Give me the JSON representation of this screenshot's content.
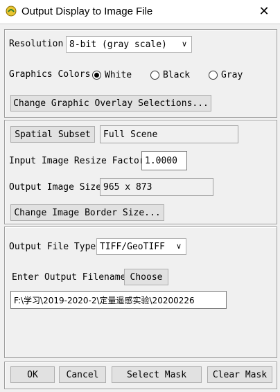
{
  "window": {
    "title": "Output Display to Image File",
    "close_glyph": "✕"
  },
  "display": {
    "resolution_label": "Resolution",
    "resolution_value": "8-bit (gray scale)",
    "graphics_colors_label": "Graphics Colors",
    "radio_white": "White",
    "radio_black": "Black",
    "radio_gray": "Gray",
    "selected_color": "White",
    "overlay_button": "Change Graphic Overlay Selections..."
  },
  "subset": {
    "spatial_subset_button": "Spatial Subset",
    "spatial_subset_value": "Full Scene",
    "resize_label": "Input Image Resize Factor",
    "resize_value": "1.0000",
    "output_size_label": "Output Image Size",
    "output_size_value": "965 x 873",
    "border_button": "Change Image Border Size..."
  },
  "output": {
    "file_type_label": "Output File Type",
    "file_type_value": "TIFF/GeoTIFF",
    "filename_label": "Enter Output Filename",
    "choose_button": "Choose",
    "filename_value": "F:\\学习\\2019-2020-2\\定量遥感实验\\20200226"
  },
  "footer": {
    "ok_button": "OK",
    "cancel_button": "Cancel",
    "select_mask_button": "Select Mask",
    "clear_mask_button": "Clear Mask"
  }
}
